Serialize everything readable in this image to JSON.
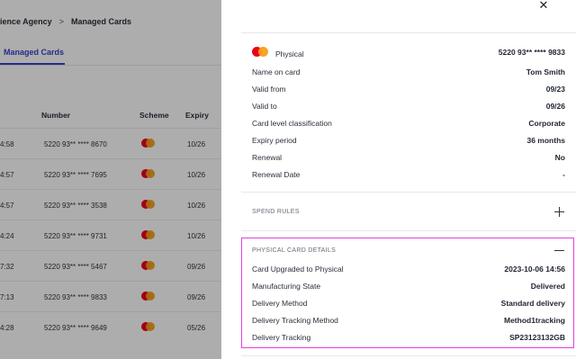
{
  "background": {
    "breadcrumb": {
      "parent": "ience Agency",
      "separator": ">",
      "current": "Managed Cards"
    },
    "active_tab": "Managed Cards",
    "table": {
      "headers": {
        "number": "Number",
        "scheme": "Scheme",
        "expiry": "Expiry"
      },
      "rows": [
        {
          "time": "4:58",
          "number": "5220 93** **** 8670",
          "expiry": "10/26"
        },
        {
          "time": "4:57",
          "number": "5220 93** **** 7695",
          "expiry": "10/26"
        },
        {
          "time": "4:57",
          "number": "5220 93** **** 3538",
          "expiry": "10/26"
        },
        {
          "time": "4:24",
          "number": "5220 93** **** 9731",
          "expiry": "10/26"
        },
        {
          "time": "7:32",
          "number": "5220 93** **** 5467",
          "expiry": "09/26"
        },
        {
          "time": "7:13",
          "number": "5220 93** **** 9833",
          "expiry": "09/26"
        },
        {
          "time": "4:28",
          "number": "5220 93** **** 9649",
          "expiry": "05/26"
        }
      ]
    }
  },
  "drawer": {
    "close_icon": "close-icon",
    "card": {
      "type": "Physical",
      "number": "5220 93** **** 9833"
    },
    "details": [
      {
        "label": "Name on card",
        "value": "Tom Smith"
      },
      {
        "label": "Valid from",
        "value": "09/23"
      },
      {
        "label": "Valid to",
        "value": "09/26"
      },
      {
        "label": "Card level classification",
        "value": "Corporate"
      },
      {
        "label": "Expiry period",
        "value": "36 months"
      },
      {
        "label": "Renewal",
        "value": "No"
      },
      {
        "label": "Renewal Date",
        "value": "-"
      }
    ],
    "spend_rules": {
      "title": "SPEND RULES",
      "icon": "plus-icon"
    },
    "physical": {
      "title": "PHYSICAL CARD DETAILS",
      "icon": "minus-icon",
      "rows": [
        {
          "label": "Card Upgraded to Physical",
          "value": "2023-10-06 14:56"
        },
        {
          "label": "Manufacturing State",
          "value": "Delivered"
        },
        {
          "label": "Delivery Method",
          "value": "Standard delivery"
        },
        {
          "label": "Delivery Tracking Method",
          "value": "Method1tracking"
        },
        {
          "label": "Delivery Tracking",
          "value": "SP23123132GB"
        }
      ]
    }
  },
  "colors": {
    "accent": "#3a3fd0",
    "highlight_border": "#e33fe0",
    "mastercard_red": "#eb001b",
    "mastercard_yellow": "#f79e1b",
    "overlay": "#000000"
  }
}
